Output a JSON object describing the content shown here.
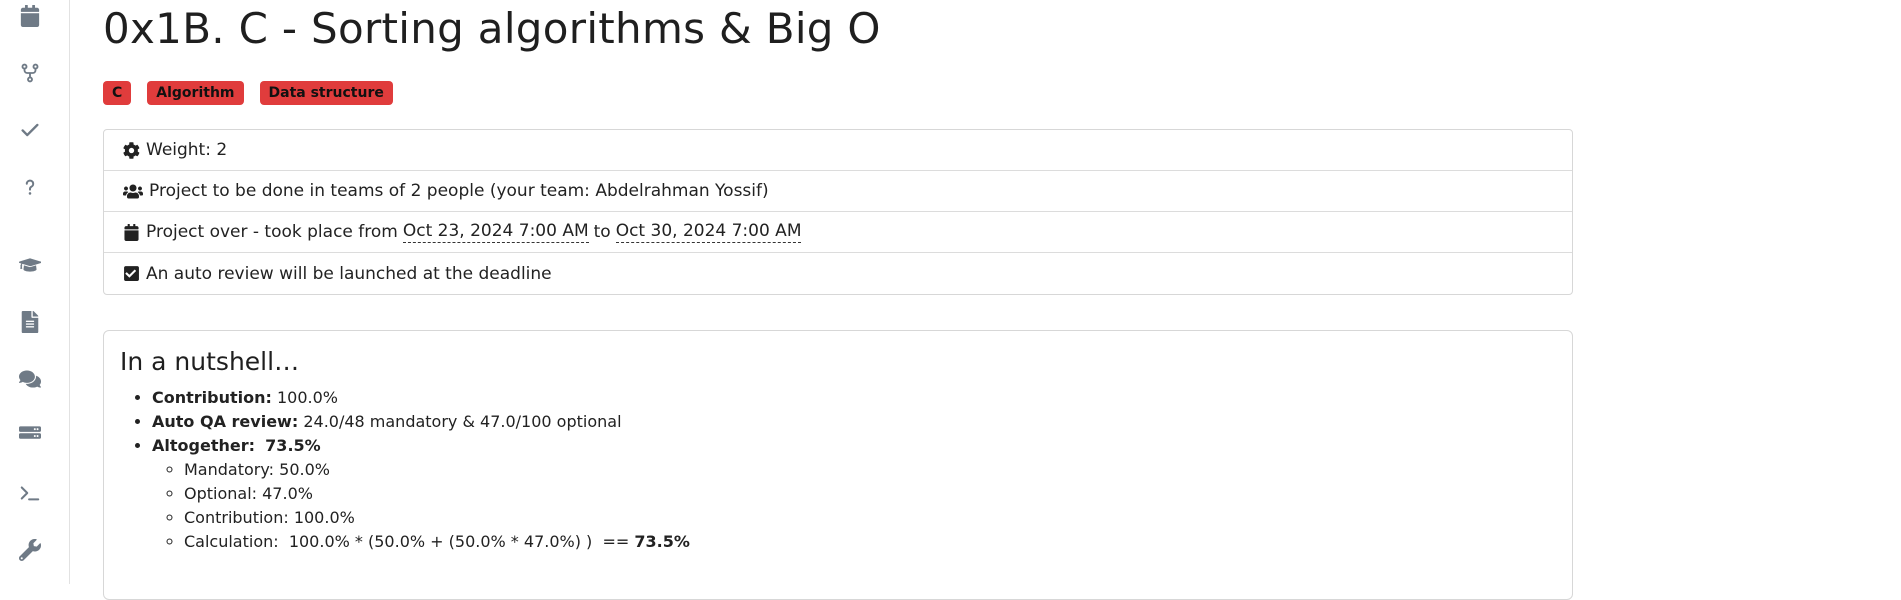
{
  "sidebar": {
    "icons": [
      "calendar-icon",
      "code-fork-icon",
      "check-icon",
      "question-icon",
      "graduation-cap-icon",
      "file-icon",
      "comments-icon",
      "server-icon",
      "terminal-icon",
      "wrench-icon"
    ]
  },
  "project": {
    "title": "0x1B. C - Sorting algorithms & Big O",
    "tags": [
      "C",
      "Algorithm",
      "Data structure"
    ]
  },
  "info": {
    "weight": "Weight: 2",
    "team": "Project to be done in teams of 2 people (your team: Abdelrahman Yossif)",
    "period_prefix": "Project over - took place from",
    "start_date": "Oct 23, 2024 7:00 AM",
    "to_word": "to",
    "end_date": "Oct 30, 2024 7:00 AM",
    "auto_review": "An auto review will be launched at the deadline"
  },
  "nutshell": {
    "heading": "In a nutshell…",
    "contribution_label": "Contribution:",
    "contribution_value": "100.0%",
    "qa_label": "Auto QA review:",
    "qa_value": "24.0/48 mandatory & 47.0/100 optional",
    "altogether_label": "Altogether:",
    "altogether_value": "73.5%",
    "mandatory": "Mandatory: 50.0%",
    "optional": "Optional: 47.0%",
    "contribution_sub": "Contribution: 100.0%",
    "calculation_text": "Calculation:  100.0% * (50.0% + (50.0% * 47.0%) )  == ",
    "calculation_result": "73.5%"
  }
}
